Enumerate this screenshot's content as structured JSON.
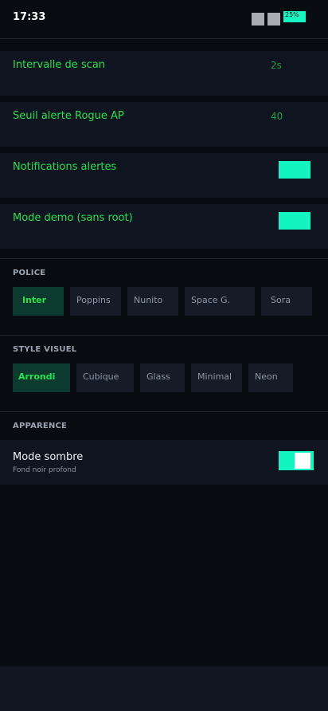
{
  "status": {
    "time": "17:33",
    "battery": "25%"
  },
  "settings": [
    {
      "label": "Intervalle de scan",
      "value": "2s"
    },
    {
      "label": "Seuil alerte Rogue AP",
      "value": "40"
    },
    {
      "label": "Notifications alertes",
      "toggle": true
    },
    {
      "label": "Mode demo (sans root)",
      "toggle": true
    }
  ],
  "police": {
    "title": "POLICE",
    "options": [
      "Inter",
      "Poppins",
      "Nunito",
      "Space G.",
      "Sora"
    ],
    "selected": "Inter"
  },
  "style_visuel": {
    "title": "STYLE VISUEL",
    "options": [
      "Arrondi",
      "Cubique",
      "Glass",
      "Minimal",
      "Neon"
    ],
    "selected": "Arrondi"
  },
  "apparence": {
    "title": "APPARENCE",
    "dark_mode": {
      "label": "Mode sombre",
      "subtitle": "Fond noir profond",
      "on": true
    }
  },
  "colors": {
    "accent": "#12f5c0",
    "label_green": "#22e04a",
    "background": "#080b10",
    "card": "#0f1520"
  }
}
